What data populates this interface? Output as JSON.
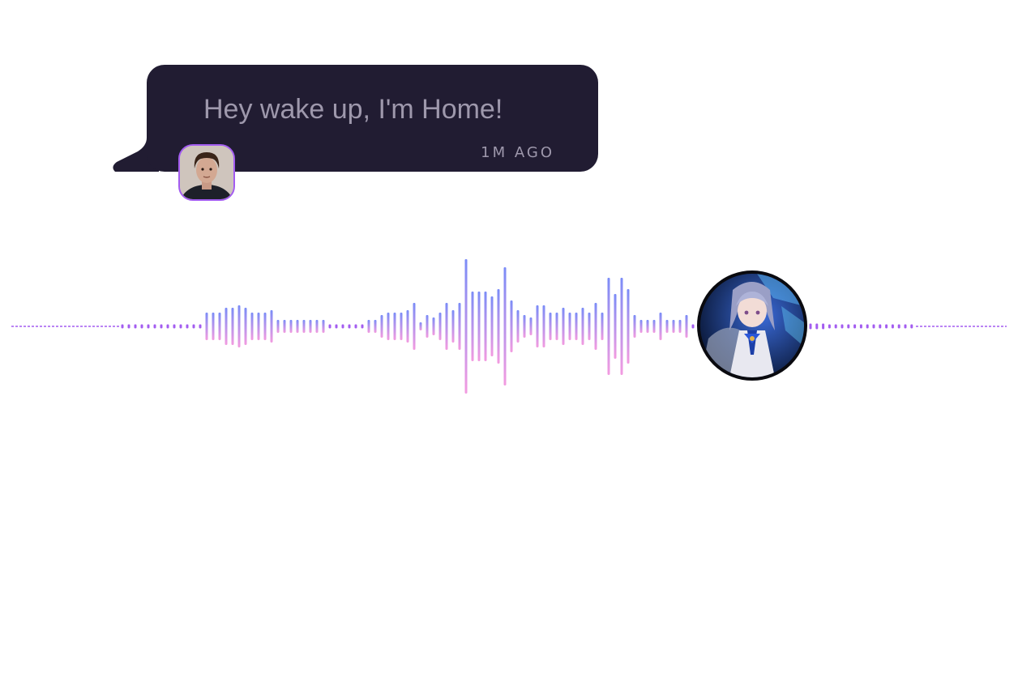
{
  "message": {
    "text": "Hey wake up, I'm Home!",
    "timestamp": "1M AGO"
  },
  "colors": {
    "bubble": "#211c32",
    "text": "#9e98ac",
    "accent": "#a35cf0",
    "wave_top": "#7b8cf7",
    "wave_bottom": "#f39be0"
  },
  "icons": {
    "user": "user-avatar-photo",
    "assistant": "assistant-avatar-anime-character"
  },
  "waveform": {
    "levels": [
      2,
      2,
      2,
      2,
      2,
      2,
      2,
      2,
      2,
      2,
      2,
      2,
      2,
      17,
      17,
      17,
      23,
      23,
      26,
      23,
      17,
      17,
      17,
      20,
      8,
      8,
      8,
      8,
      8,
      8,
      8,
      8,
      2,
      2,
      2,
      2,
      2,
      2,
      8,
      8,
      14,
      17,
      17,
      17,
      20,
      29,
      5,
      14,
      11,
      17,
      29,
      20,
      29,
      83,
      43,
      43,
      43,
      37,
      46,
      73,
      32,
      20,
      14,
      11,
      26,
      26,
      17,
      17,
      23,
      17,
      17,
      23,
      17,
      29,
      17,
      60,
      40,
      60,
      46,
      14,
      8,
      8,
      8,
      17,
      8,
      8,
      8,
      14,
      2
    ],
    "right_dots": 17
  }
}
